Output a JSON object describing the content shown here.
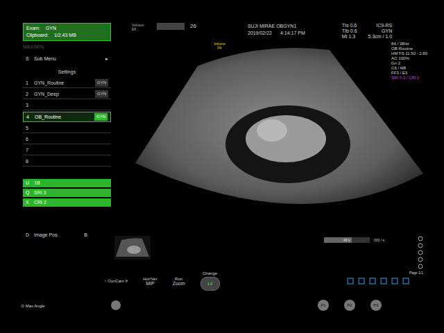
{
  "exam": {
    "exam_label": "Exam:",
    "exam": "GYN",
    "clip_label": "Clipboard:",
    "clip": "1/2.43 MB"
  },
  "menu_hint": "MAX/MIN",
  "submenu": {
    "key": "S",
    "label": "Sub Menu",
    "arrow": "▸"
  },
  "settings": {
    "title": "Settings",
    "items": [
      {
        "key": "1",
        "label": "GYN_Routine",
        "tag": "GYN",
        "selected": false
      },
      {
        "key": "2",
        "label": "GYN_Deep",
        "tag": "GYN",
        "selected": false
      },
      {
        "key": "3",
        "label": "",
        "tag": "",
        "selected": false
      },
      {
        "key": "4",
        "label": "OB_Routine",
        "tag": "GYN",
        "selected": true
      },
      {
        "key": "5",
        "label": "",
        "tag": "",
        "selected": false
      },
      {
        "key": "6",
        "label": "",
        "tag": "",
        "selected": false
      },
      {
        "key": "7",
        "label": "",
        "tag": "",
        "selected": false
      },
      {
        "key": "8",
        "label": "",
        "tag": "",
        "selected": false
      }
    ]
  },
  "toggles": [
    {
      "key": "U",
      "label": "1B",
      "on": true
    },
    {
      "key": "Q",
      "label": "SRI 3",
      "on": true
    },
    {
      "key": "X",
      "label": "CRI 2",
      "on": true
    }
  ],
  "image_pos": {
    "key": "D",
    "label": "Image Pos.",
    "value": "B"
  },
  "header": {
    "logo": "Voluson",
    "logo_model": "E8",
    "age": "26",
    "institution": "SUJI MIRAE OBGYN1",
    "date": "2019/02/22",
    "time": "4:14:17 PM",
    "safety": [
      "TIs 0.6",
      "TIb 0.6",
      "MI 1.3"
    ],
    "probe": [
      "IC9-RS",
      "GYN",
      "5.3cm / 1.0"
    ]
  },
  "params": [
    {
      "text": "84 / 38Hz",
      "color": "#d8d8d8"
    },
    {
      "text": "OB Routine",
      "color": "#d8d8d8"
    },
    {
      "text": "HM FS 11.50 - 2.80",
      "color": "#d8d8d8"
    },
    {
      "text": "AO 100%",
      "color": "#d8d8d8"
    },
    {
      "text": "Gn 2",
      "color": "#d8d8d8"
    },
    {
      "text": "C6 / M8",
      "color": "#d8d8d8"
    },
    {
      "text": "FF3 / E3",
      "color": "#d8d8d8"
    },
    {
      "text": "SRI II 3 / CRI 2",
      "color": "#d040e0"
    }
  ],
  "image": {
    "marker_top": "Volume",
    "marker": "P4"
  },
  "gauge": {
    "label": "48 k",
    "level": 0.6,
    "reading": "333 / s"
  },
  "page": "Page 1/1",
  "cine": "OynCam fr",
  "max_angle": "Max Angle",
  "controls": [
    {
      "label": "Hor/Ver",
      "value": "MIP"
    },
    {
      "label": "Run",
      "value": "Zoom"
    }
  ],
  "change": {
    "label": "Change",
    "center": "1.0"
  },
  "p_buttons": [
    "P1",
    "P2",
    "P3"
  ]
}
